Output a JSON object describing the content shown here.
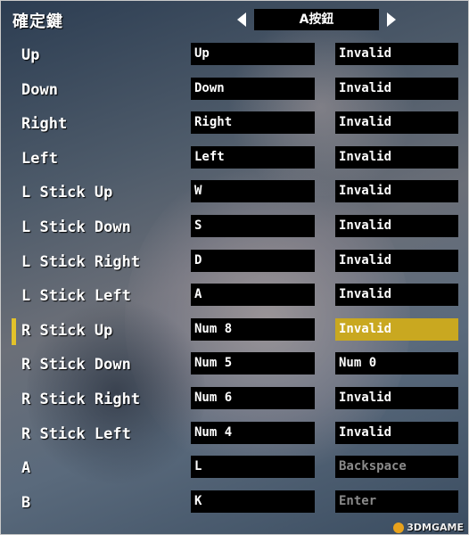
{
  "header": {
    "title": "確定鍵",
    "selector_value": "A按鈕"
  },
  "rows": [
    {
      "label": "Up",
      "key1": "Up",
      "key2": "Invalid",
      "key2_dim": false,
      "selected": false
    },
    {
      "label": "Down",
      "key1": "Down",
      "key2": "Invalid",
      "key2_dim": false,
      "selected": false
    },
    {
      "label": "Right",
      "key1": "Right",
      "key2": "Invalid",
      "key2_dim": false,
      "selected": false
    },
    {
      "label": "Left",
      "key1": "Left",
      "key2": "Invalid",
      "key2_dim": false,
      "selected": false
    },
    {
      "label": "L Stick Up",
      "key1": "W",
      "key2": "Invalid",
      "key2_dim": false,
      "selected": false
    },
    {
      "label": "L Stick Down",
      "key1": "S",
      "key2": "Invalid",
      "key2_dim": false,
      "selected": false
    },
    {
      "label": "L Stick Right",
      "key1": "D",
      "key2": "Invalid",
      "key2_dim": false,
      "selected": false
    },
    {
      "label": "L Stick Left",
      "key1": "A",
      "key2": "Invalid",
      "key2_dim": false,
      "selected": false
    },
    {
      "label": "R Stick Up",
      "key1": "Num 8",
      "key2": "Invalid",
      "key2_dim": false,
      "selected": true
    },
    {
      "label": "R Stick Down",
      "key1": "Num 5",
      "key2": "Num 0",
      "key2_dim": false,
      "selected": false
    },
    {
      "label": "R Stick Right",
      "key1": "Num 6",
      "key2": "Invalid",
      "key2_dim": false,
      "selected": false
    },
    {
      "label": "R Stick Left",
      "key1": "Num 4",
      "key2": "Invalid",
      "key2_dim": false,
      "selected": false
    },
    {
      "label": "A",
      "key1": "L",
      "key2": "Backspace",
      "key2_dim": true,
      "selected": false
    },
    {
      "label": "B",
      "key1": "K",
      "key2": "Enter",
      "key2_dim": true,
      "selected": false
    }
  ],
  "watermark": "3DMGAME",
  "colors": {
    "highlight": "#c9a820",
    "marker": "#e3c22a",
    "box_bg": "#000000"
  }
}
